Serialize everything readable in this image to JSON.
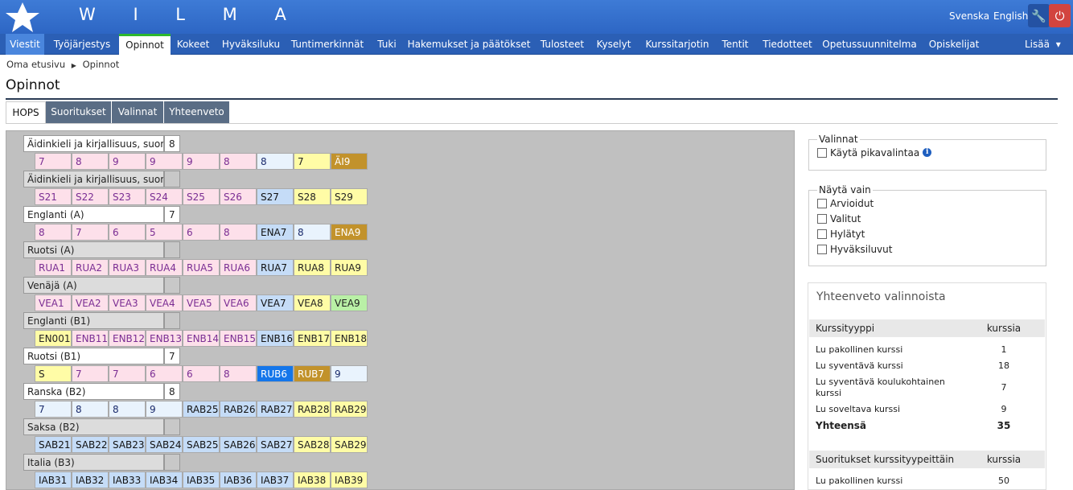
{
  "header": {
    "brand": "W I L M A",
    "lang_sv": "Svenska",
    "lang_en": "English"
  },
  "nav": {
    "items": [
      "Viestit",
      "Työjärjestys",
      "Opinnot",
      "Kokeet",
      "Hyväksiluku",
      "Tuntimerkinnät",
      "Tuki",
      "Hakemukset ja päätökset",
      "Tulosteet",
      "Kyselyt",
      "Kurssitarjotin",
      "Tentit",
      "Tiedotteet",
      "Opetussuunnitelma",
      "Opiskelijat"
    ],
    "active": "Opinnot",
    "more": "Lisää"
  },
  "breadcrumb": {
    "home": "Oma etusivu",
    "current": "Opinnot"
  },
  "page": {
    "title": "Opinnot"
  },
  "tabs": [
    "HOPS",
    "Suoritukset",
    "Valinnat",
    "Yhteenveto"
  ],
  "subjects": [
    {
      "name": "Äidinkieli ja kirjallisuus, suomi ä",
      "grade": "8",
      "white": true,
      "courses": [
        [
          "7",
          "p"
        ],
        [
          "8",
          "p"
        ],
        [
          "9",
          "p"
        ],
        [
          "9",
          "p"
        ],
        [
          "9",
          "p"
        ],
        [
          "8",
          "p"
        ],
        [
          "8",
          "b"
        ],
        [
          "7",
          "y"
        ],
        [
          "ÄI9",
          "g"
        ]
      ]
    },
    {
      "name": "Äidinkieli ja kirjallisuus, suomi t",
      "grade": "",
      "white": false,
      "courses": [
        [
          "S21",
          "p"
        ],
        [
          "S22",
          "p"
        ],
        [
          "S23",
          "p"
        ],
        [
          "S24",
          "p"
        ],
        [
          "S25",
          "p"
        ],
        [
          "S26",
          "p"
        ],
        [
          "S27",
          "bl"
        ],
        [
          "S28",
          "y"
        ],
        [
          "S29",
          "y"
        ]
      ]
    },
    {
      "name": "Englanti (A)",
      "grade": "7",
      "white": true,
      "courses": [
        [
          "8",
          "p"
        ],
        [
          "7",
          "p"
        ],
        [
          "6",
          "p"
        ],
        [
          "5",
          "p"
        ],
        [
          "6",
          "p"
        ],
        [
          "8",
          "p"
        ],
        [
          "ENA7",
          "bl"
        ],
        [
          "8",
          "b"
        ],
        [
          "ENA9",
          "g"
        ]
      ]
    },
    {
      "name": "Ruotsi (A)",
      "grade": "",
      "white": false,
      "courses": [
        [
          "RUA1",
          "p"
        ],
        [
          "RUA2",
          "p"
        ],
        [
          "RUA3",
          "p"
        ],
        [
          "RUA4",
          "p"
        ],
        [
          "RUA5",
          "p"
        ],
        [
          "RUA6",
          "p"
        ],
        [
          "RUA7",
          "bl"
        ],
        [
          "RUA8",
          "y"
        ],
        [
          "RUA9",
          "y"
        ]
      ]
    },
    {
      "name": "Venäjä (A)",
      "grade": "",
      "white": false,
      "courses": [
        [
          "VEA1",
          "p"
        ],
        [
          "VEA2",
          "p"
        ],
        [
          "VEA3",
          "p"
        ],
        [
          "VEA4",
          "p"
        ],
        [
          "VEA5",
          "p"
        ],
        [
          "VEA6",
          "p"
        ],
        [
          "VEA7",
          "bl"
        ],
        [
          "VEA8",
          "y"
        ],
        [
          "VEA9",
          "gr"
        ]
      ]
    },
    {
      "name": "Englanti (B1)",
      "grade": "",
      "white": false,
      "courses": [
        [
          "EN001",
          "y"
        ],
        [
          "ENB11",
          "p"
        ],
        [
          "ENB12",
          "p"
        ],
        [
          "ENB13",
          "p"
        ],
        [
          "ENB14",
          "p"
        ],
        [
          "ENB15",
          "p"
        ],
        [
          "ENB16",
          "bl"
        ],
        [
          "ENB17",
          "y"
        ],
        [
          "ENB18",
          "y"
        ]
      ]
    },
    {
      "name": "Ruotsi (B1)",
      "grade": "7",
      "white": true,
      "courses": [
        [
          "S",
          "y"
        ],
        [
          "7",
          "p"
        ],
        [
          "7",
          "p"
        ],
        [
          "6",
          "p"
        ],
        [
          "6",
          "p"
        ],
        [
          "8",
          "p"
        ],
        [
          "RUB6",
          "db"
        ],
        [
          "RUB7",
          "g"
        ],
        [
          "9",
          "b"
        ]
      ]
    },
    {
      "name": "Ranska (B2)",
      "grade": "8",
      "white": true,
      "courses": [
        [
          "7",
          "b"
        ],
        [
          "8",
          "b"
        ],
        [
          "8",
          "b"
        ],
        [
          "9",
          "b"
        ],
        [
          "RAB25",
          "bl"
        ],
        [
          "RAB26",
          "bl"
        ],
        [
          "RAB27",
          "bl"
        ],
        [
          "RAB28",
          "y"
        ],
        [
          "RAB29",
          "y"
        ]
      ]
    },
    {
      "name": "Saksa (B2)",
      "grade": "",
      "white": false,
      "courses": [
        [
          "SAB21",
          "bl"
        ],
        [
          "SAB22",
          "bl"
        ],
        [
          "SAB23",
          "bl"
        ],
        [
          "SAB24",
          "bl"
        ],
        [
          "SAB25",
          "bl"
        ],
        [
          "SAB26",
          "bl"
        ],
        [
          "SAB27",
          "bl"
        ],
        [
          "SAB28",
          "y"
        ],
        [
          "SAB29",
          "y"
        ]
      ]
    },
    {
      "name": "Italia (B3)",
      "grade": "",
      "white": false,
      "courses": [
        [
          "IAB31",
          "bl"
        ],
        [
          "IAB32",
          "bl"
        ],
        [
          "IAB33",
          "bl"
        ],
        [
          "IAB34",
          "bl"
        ],
        [
          "IAB35",
          "bl"
        ],
        [
          "IAB36",
          "bl"
        ],
        [
          "IAB37",
          "bl"
        ],
        [
          "IAB38",
          "y"
        ],
        [
          "IAB39",
          "y"
        ]
      ]
    }
  ],
  "valinnat": {
    "legend": "Valinnat",
    "quick": "Käytä pikavalintaa"
  },
  "nayta": {
    "legend": "Näytä vain",
    "options": [
      "Arvioidut",
      "Valitut",
      "Hylätyt",
      "Hyväksiluvut"
    ]
  },
  "summary": {
    "title": "Yhteenveto valinnoista",
    "col1": "Kurssityyppi",
    "col2": "kurssia",
    "rows": [
      {
        "label": "Lu pakollinen kurssi",
        "value": "1"
      },
      {
        "label": "Lu syventävä kurssi",
        "value": "18"
      },
      {
        "label": "Lu syventävä koulukohtainen kurssi",
        "value": "7"
      },
      {
        "label": "Lu soveltava kurssi",
        "value": "9"
      }
    ],
    "total_label": "Yhteensä",
    "total_value": "35",
    "sub_col1": "Suoritukset kurssityypeittäin",
    "sub_col2": "kurssia",
    "sub_rows": [
      {
        "label": "Lu pakollinen kurssi",
        "value": "50"
      }
    ]
  },
  "colors": {
    "p": "#fde0ea",
    "b": "#e9f3fd",
    "bl": "#c5dcf7",
    "y": "#fffca6",
    "g": "#c2922b",
    "gr": "#b9f0a6",
    "db": "#1476ea"
  }
}
